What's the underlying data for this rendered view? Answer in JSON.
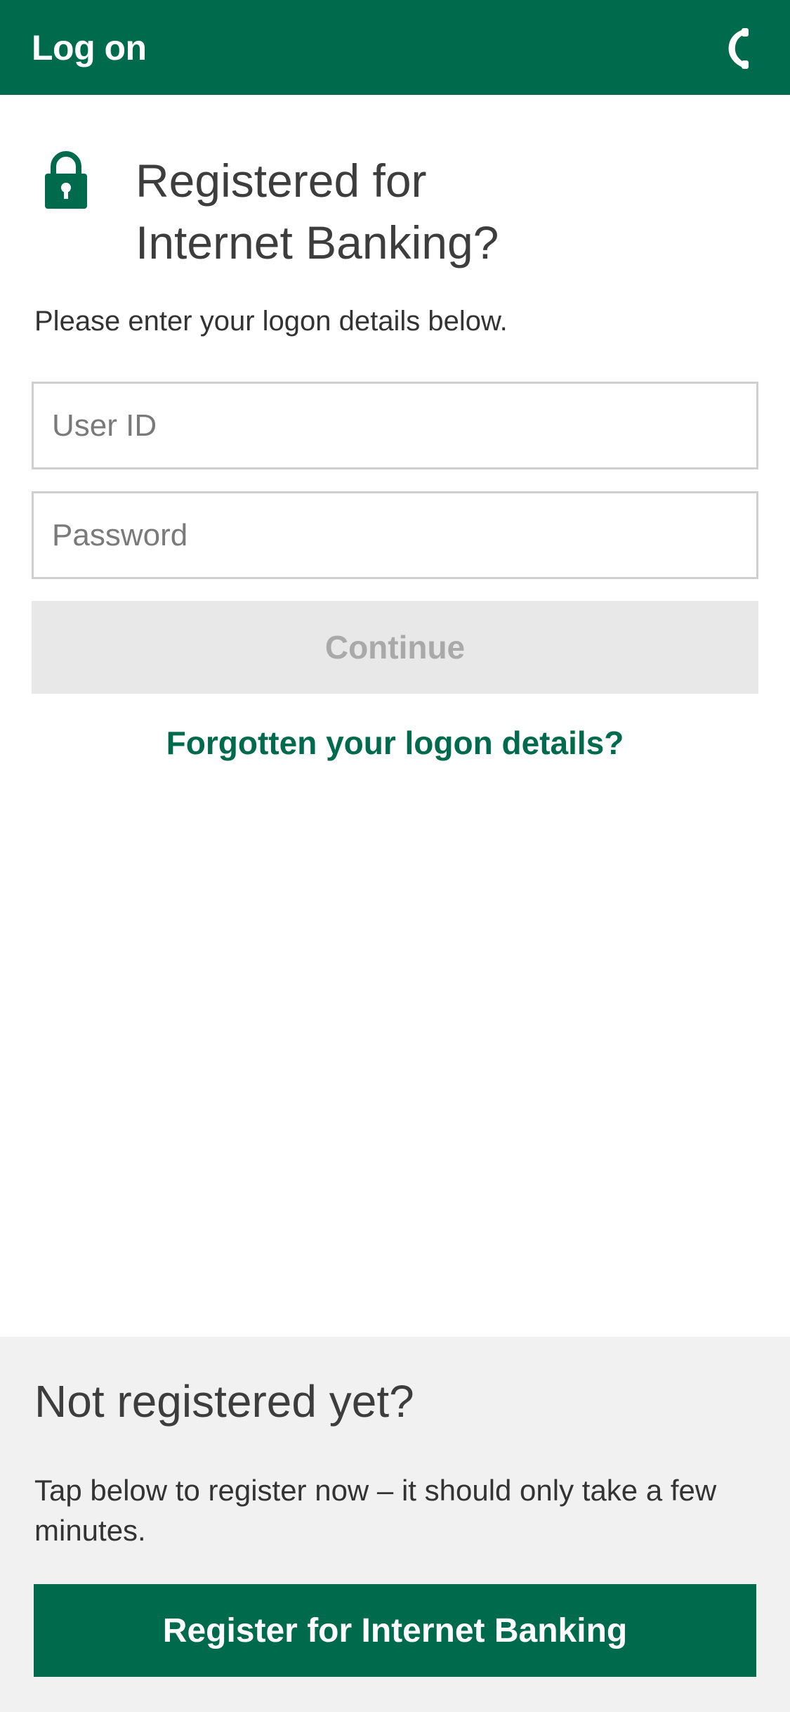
{
  "header": {
    "title": "Log on",
    "phone_icon": "phone-icon"
  },
  "registered": {
    "lock_icon": "lock-icon",
    "heading_line1": "Registered for",
    "heading_line2": "Internet Banking?",
    "subtext": "Please enter your logon details below.",
    "user_id_placeholder": "User ID",
    "user_id_value": "",
    "password_placeholder": "Password",
    "password_value": "",
    "continue_label": "Continue",
    "forgot_label": "Forgotten your logon details?"
  },
  "not_registered": {
    "heading": "Not registered yet?",
    "text": "Tap below to register now – it should only take a few minutes.",
    "register_label": "Register for Internet Banking"
  },
  "colors": {
    "brand_green": "#006a4d",
    "disabled_bg": "#e8e8e8",
    "disabled_text": "#a9a9a9",
    "panel_bg": "#f1f1f1"
  }
}
